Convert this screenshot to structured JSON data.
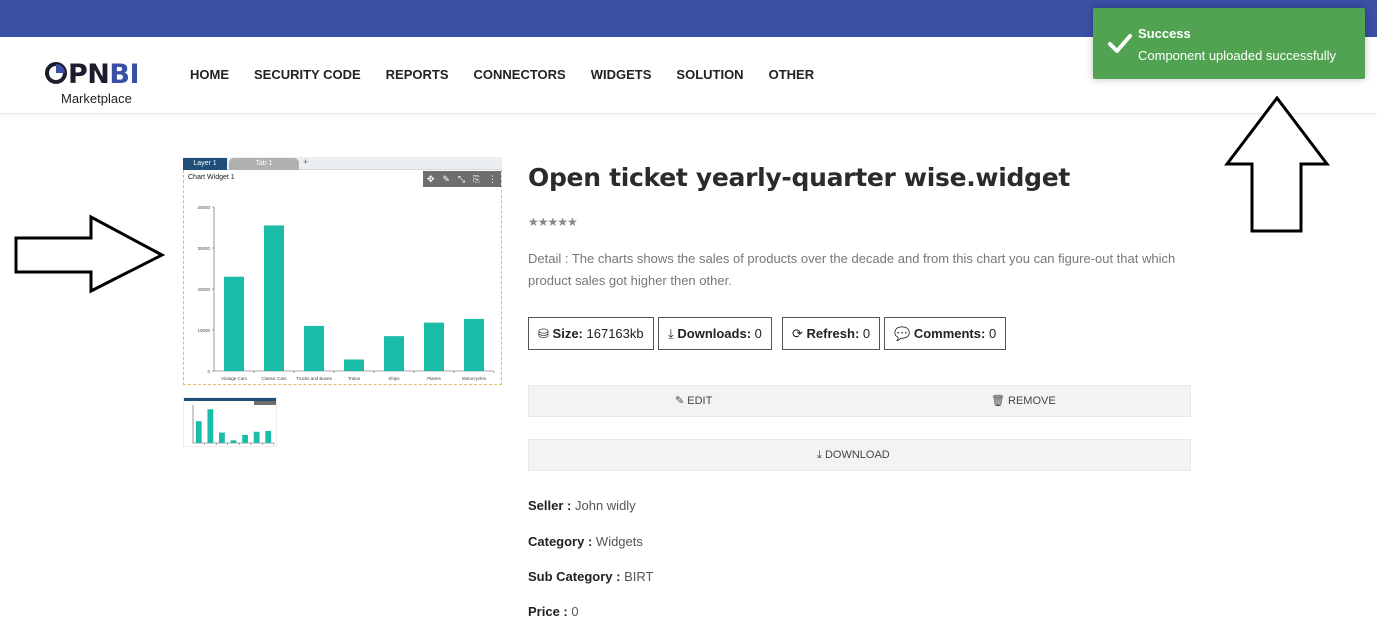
{
  "nav": {
    "logo_main_a": "PN",
    "logo_main_b": "BI",
    "logo_sub": "Marketplace",
    "items": [
      "HOME",
      "SECURITY CODE",
      "REPORTS",
      "CONNECTORS",
      "WIDGETS",
      "SOLUTION",
      "OTHER"
    ]
  },
  "toast": {
    "title": "Success",
    "message": "Component uploaded successfully",
    "color": "#51a351"
  },
  "widget": {
    "tabs": [
      "Layer 1",
      "Tab 1",
      "+"
    ],
    "title": "Chart Widget 1"
  },
  "chart_data": {
    "type": "bar",
    "categories": [
      "Vintage Cars",
      "Classic Cars",
      "Trucks and Buses",
      "Trains",
      "Ships",
      "Planes",
      "Motorcycles"
    ],
    "values": [
      23000,
      35500,
      11000,
      2800,
      8500,
      11800,
      12700
    ],
    "yticks": [
      "0",
      "10000",
      "20000",
      "30000",
      "40000"
    ],
    "ylim": [
      0,
      40000
    ],
    "color": "#1bbca8"
  },
  "product": {
    "title": "Open ticket yearly-quarter wise.widget",
    "stars": "★★★★★",
    "detail": "Detail : The charts shows the sales of products over the decade and from this chart you can figure-out that which product sales got higher then other.",
    "size_label": "Size:",
    "size_value": "167163kb",
    "downloads_label": "Downloads:",
    "downloads_value": "0",
    "refresh_label": "Refresh:",
    "refresh_value": "0",
    "comments_label": "Comments:",
    "comments_value": "0",
    "edit_label": "EDIT",
    "remove_label": "REMOVE",
    "download_label": "DOWNLOAD",
    "seller_label": "Seller :",
    "seller_value": "John widly",
    "category_label": "Category :",
    "category_value": "Widgets",
    "subcategory_label": "Sub Category :",
    "subcategory_value": "BIRT",
    "price_label": "Price :",
    "price_value": "0"
  }
}
